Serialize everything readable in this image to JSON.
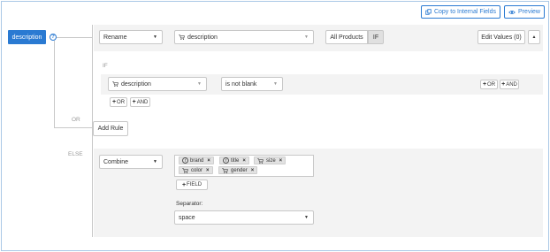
{
  "toolbar": {
    "copy_label": "Copy to Internal Fields",
    "preview_label": "Preview"
  },
  "field": {
    "name": "description",
    "help_icon": "question-circle-icon"
  },
  "rule": {
    "action": "Rename",
    "source_field": "description",
    "all_products_label": "All Products",
    "if_label": "IF",
    "edit_values_label": "Edit Values (0)"
  },
  "if_block": {
    "label": "IF",
    "condition_field": "description",
    "operator": "is not blank",
    "or_label": "OR",
    "and_label": "AND"
  },
  "or_label": "OR",
  "add_rule_label": "Add Rule",
  "else_block": {
    "label": "ELSE",
    "action": "Combine",
    "tags": [
      {
        "type": "function",
        "label": "brand"
      },
      {
        "type": "function",
        "label": "title"
      },
      {
        "type": "cart",
        "label": "size"
      },
      {
        "type": "cart",
        "label": "color"
      },
      {
        "type": "cart",
        "label": "gender"
      }
    ],
    "add_field_label": "FIELD",
    "separator_label": "Separator:",
    "separator_value": "space"
  },
  "colors": {
    "accent": "#2a7ad2",
    "panel_bg": "#f3f3f3",
    "border": "#c8c8c8"
  }
}
